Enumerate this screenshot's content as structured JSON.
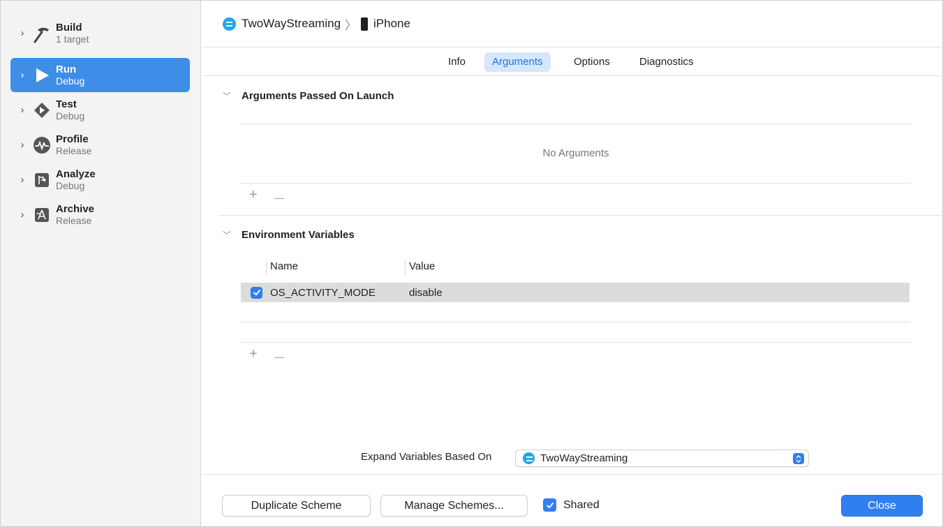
{
  "sidebar": {
    "items": [
      {
        "title": "Build",
        "subtitle": "1 target",
        "icon": "hammer-icon",
        "selected": false
      },
      {
        "title": "Run",
        "subtitle": "Debug",
        "icon": "play-icon",
        "selected": true
      },
      {
        "title": "Test",
        "subtitle": "Debug",
        "icon": "test-diamond-icon",
        "selected": false
      },
      {
        "title": "Profile",
        "subtitle": "Release",
        "icon": "waveform-icon",
        "selected": false
      },
      {
        "title": "Analyze",
        "subtitle": "Debug",
        "icon": "analyze-icon",
        "selected": false
      },
      {
        "title": "Archive",
        "subtitle": "Release",
        "icon": "archive-app-icon",
        "selected": false
      }
    ]
  },
  "breadcrumb": {
    "project": "TwoWayStreaming",
    "separator": "〉",
    "device": "iPhone"
  },
  "tabs": [
    {
      "label": "Info",
      "active": false
    },
    {
      "label": "Arguments",
      "active": true
    },
    {
      "label": "Options",
      "active": false
    },
    {
      "label": "Diagnostics",
      "active": false
    }
  ],
  "arguments": {
    "title": "Arguments Passed On Launch",
    "empty_text": "No Arguments"
  },
  "environment": {
    "title": "Environment Variables",
    "columns": {
      "name": "Name",
      "value": "Value"
    },
    "rows": [
      {
        "enabled": true,
        "name": "OS_ACTIVITY_MODE",
        "value": "disable"
      }
    ]
  },
  "controls": {
    "plus": "+",
    "minus": "—"
  },
  "expand": {
    "label": "Expand Variables Based On",
    "selected": "TwoWayStreaming"
  },
  "footer": {
    "duplicate": "Duplicate Scheme",
    "manage": "Manage Schemes...",
    "shared_label": "Shared",
    "shared_checked": true,
    "close": "Close"
  },
  "colors": {
    "accent": "#2f7ff0",
    "sidebar_selected": "#3e8ee8",
    "tab_active_bg": "#d6e6fb",
    "project_icon": "#1fa6e8"
  }
}
